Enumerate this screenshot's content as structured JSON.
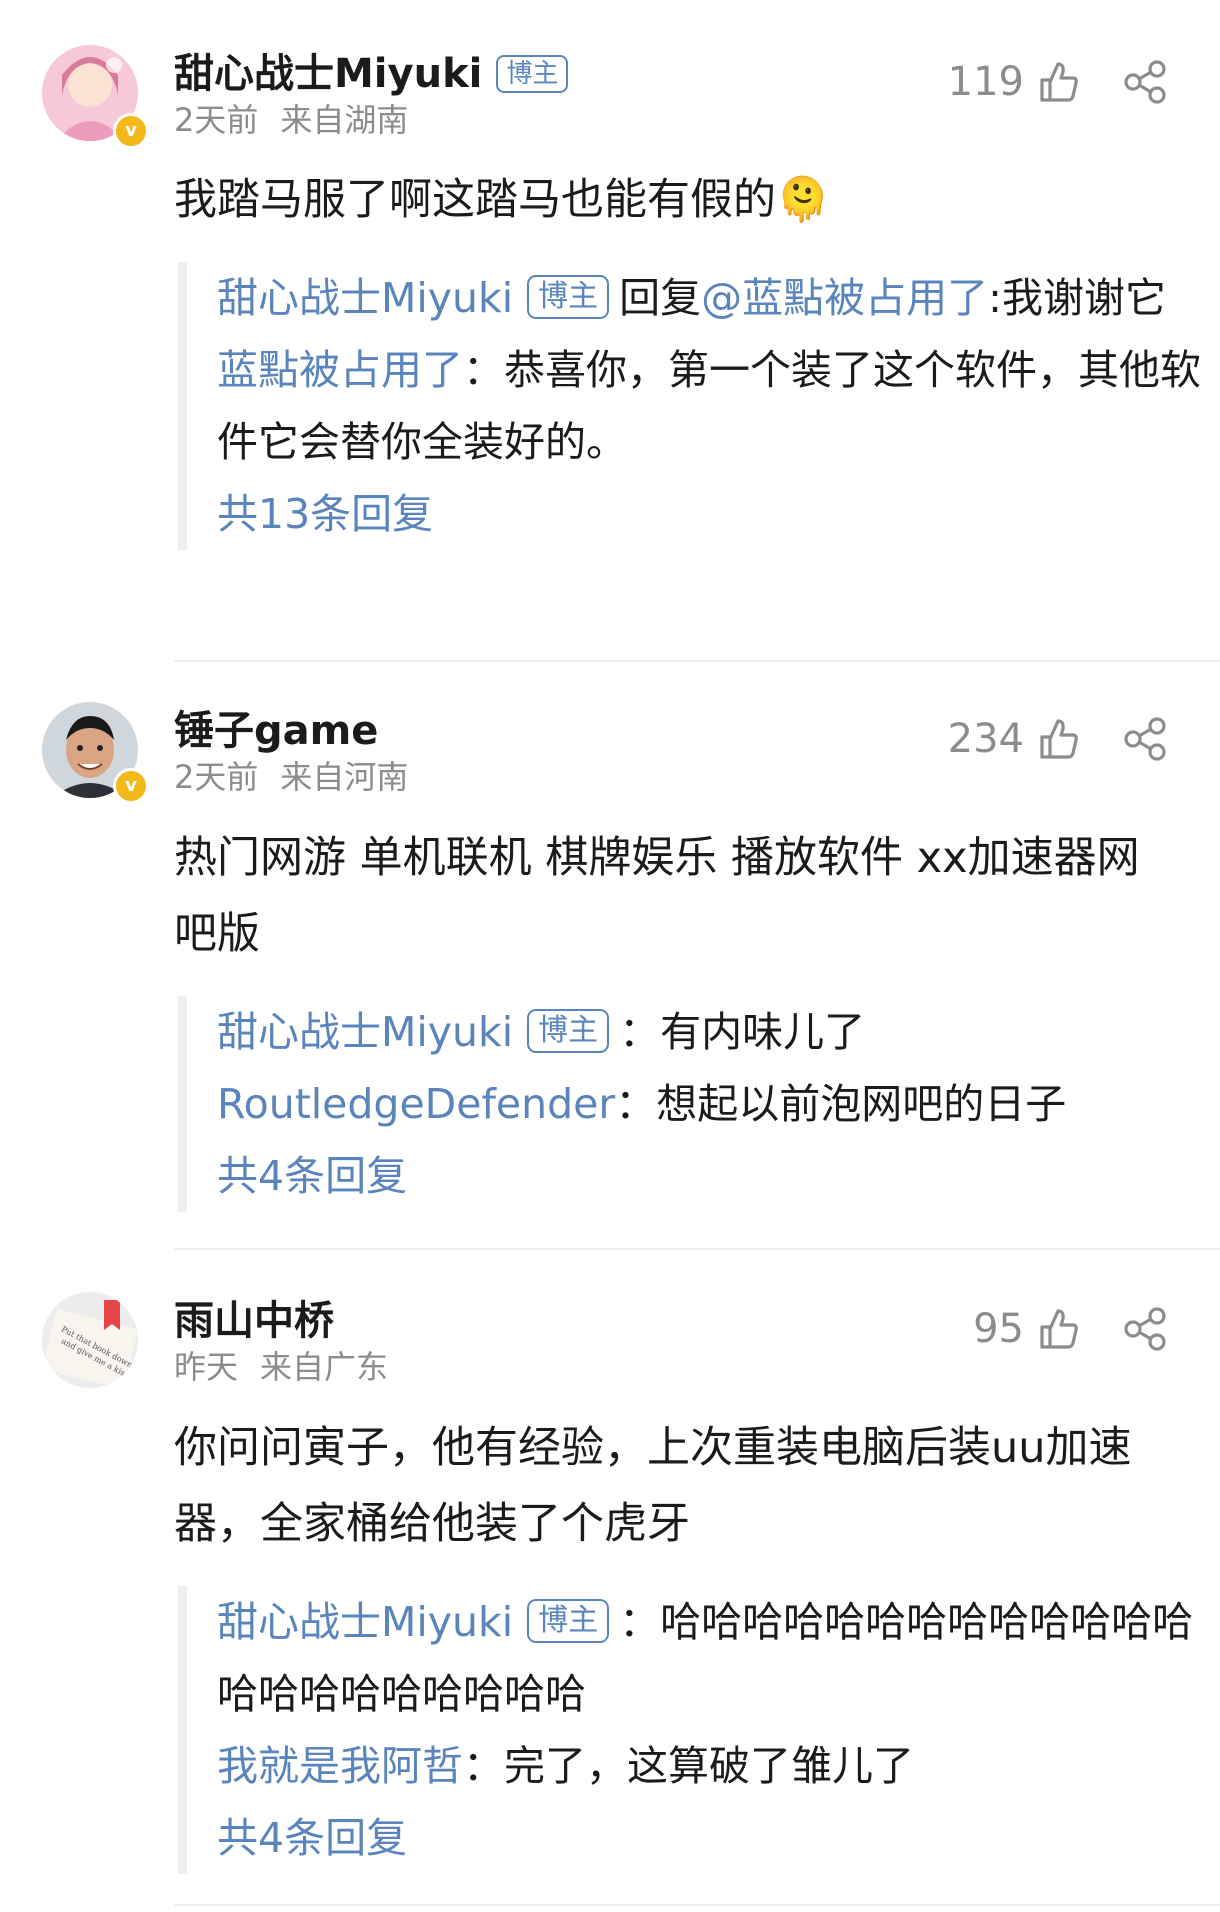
{
  "comments": [
    {
      "username": "甜心战士Miyuki",
      "badge": "博主",
      "meta_time": "2天前",
      "meta_location": "来自湖南",
      "likes": "119",
      "text": "我踏马服了啊这踏马也能有假的🫠",
      "reply_lines": [
        {
          "name": "甜心战士Miyuki",
          "badge": "博主",
          "prefix": "回复",
          "mention": "@蓝點被占用了",
          "text": ":我谢谢它"
        },
        {
          "name": "蓝點被占用了",
          "text": "：恭喜你，第一个装了这个软件，其他软件它会替你全装好的。"
        }
      ],
      "more": "共13条回复"
    },
    {
      "username": "锤子game",
      "meta_time": "2天前",
      "meta_location": "来自河南",
      "likes": "234",
      "text": "热门网游 单机联机 棋牌娱乐 播放软件 xx加速器网吧版",
      "reply_lines": [
        {
          "name": "甜心战士Miyuki",
          "badge": "博主",
          "text": "：有内味儿了"
        },
        {
          "name": "RoutledgeDefender",
          "text": "：想起以前泡网吧的日子"
        }
      ],
      "more": "共4条回复"
    },
    {
      "username": "雨山中桥",
      "meta_time": "昨天",
      "meta_location": "来自广东",
      "likes": "95",
      "text": "你问问寅子，他有经验，上次重装电脑后装uu加速器，全家桶给他装了个虎牙",
      "reply_lines": [
        {
          "name": "甜心战士Miyuki",
          "badge": "博主",
          "text": "：哈哈哈哈哈哈哈哈哈哈哈哈哈哈哈哈哈哈哈哈哈哈"
        },
        {
          "name": "我就是我阿哲",
          "text": "：完了，这算破了雏儿了"
        }
      ],
      "more": "共4条回复"
    }
  ],
  "icons": {
    "like": "thumbs-up-outline-icon",
    "share": "share-nodes-icon",
    "verified": "verified-v-badge-icon"
  },
  "colors": {
    "link": "#5a84bc",
    "meta": "#8c8c8c",
    "verified": "#f3b81a"
  },
  "avatar_texts": {
    "book_avatar_line1": "Put that book down",
    "book_avatar_line2": "and give me a kiss"
  }
}
